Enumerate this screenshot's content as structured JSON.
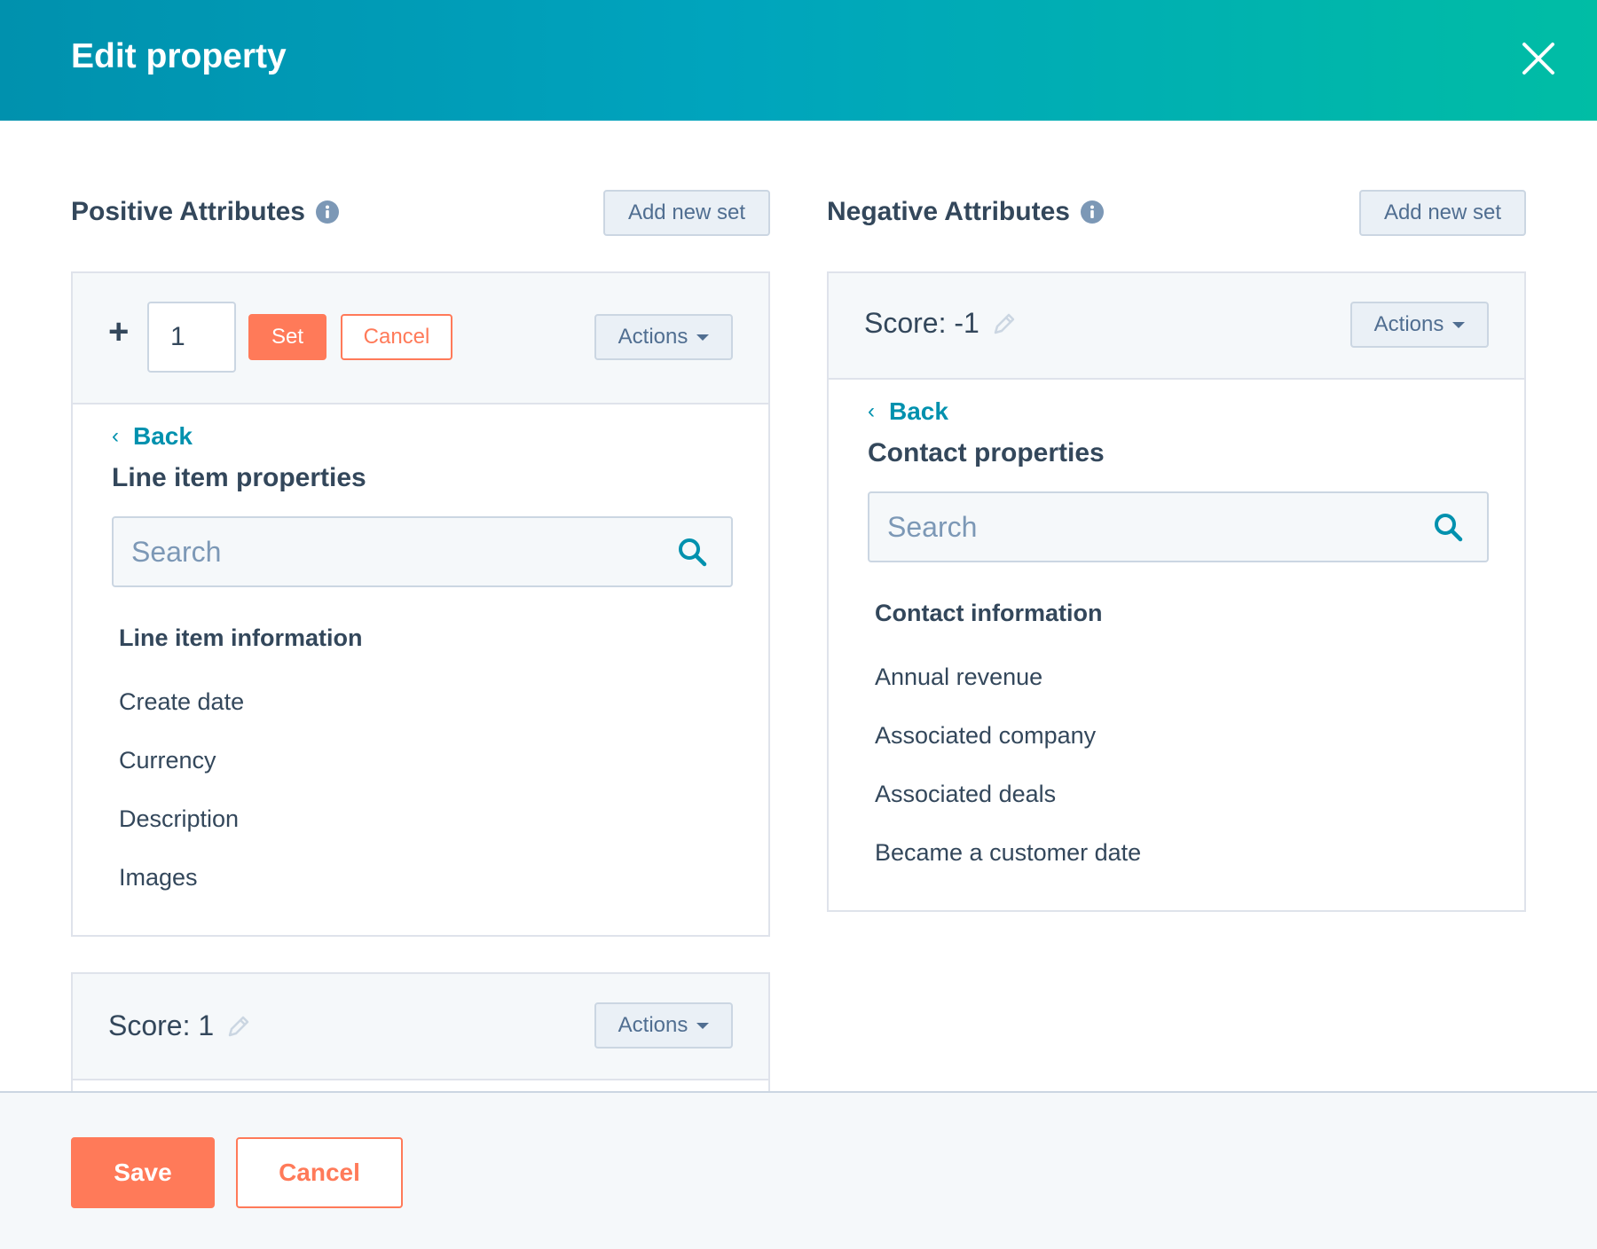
{
  "header": {
    "title": "Edit property",
    "close_icon": "close-icon"
  },
  "positive": {
    "title": "Positive Attributes",
    "add_new_set": "Add new set",
    "editing_set": {
      "plus": "+",
      "score_value": "1",
      "set_label": "Set",
      "cancel_label": "Cancel",
      "actions_label": "Actions",
      "back_label": "Back",
      "group_title": "Line item properties",
      "search_placeholder": "Search",
      "list_heading": "Line item information",
      "items": [
        "Create date",
        "Currency",
        "Description",
        "Images"
      ]
    },
    "second_set": {
      "score_label": "Score: 1",
      "actions_label": "Actions"
    }
  },
  "negative": {
    "title": "Negative Attributes",
    "add_new_set": "Add new set",
    "set": {
      "score_label": "Score: -1",
      "actions_label": "Actions",
      "back_label": "Back",
      "group_title": "Contact properties",
      "search_placeholder": "Search",
      "list_heading": "Contact information",
      "items": [
        "Annual revenue",
        "Associated company",
        "Associated deals",
        "Became a customer date"
      ]
    }
  },
  "footer": {
    "save_label": "Save",
    "cancel_label": "Cancel"
  },
  "colors": {
    "accent": "#ff7a59",
    "link": "#0091ae",
    "header_start": "#0091ae",
    "header_end": "#00bda5"
  }
}
